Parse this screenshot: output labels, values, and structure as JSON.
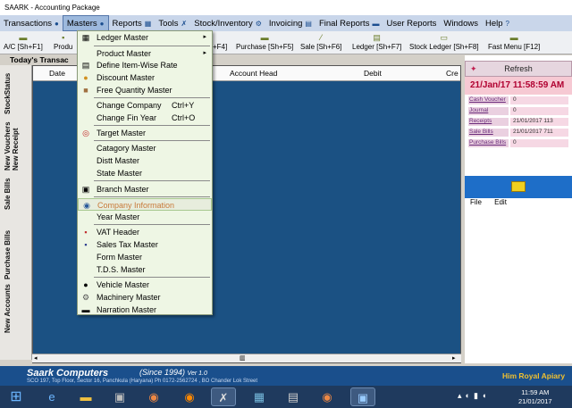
{
  "window": {
    "title": "SAARK - Accounting Package"
  },
  "menubar": [
    {
      "label": "Transactions",
      "icon": "globe-icon"
    },
    {
      "label": "Masters",
      "icon": "globe-icon",
      "active": true
    },
    {
      "label": "Reports",
      "icon": "table-icon"
    },
    {
      "label": "Tools",
      "icon": "wrench-icon"
    },
    {
      "label": "Stock/Inventory",
      "icon": "gear-icon"
    },
    {
      "label": "Invoicing",
      "icon": "document-icon"
    },
    {
      "label": "Final Reports",
      "icon": "panel-icon"
    },
    {
      "label": "User Reports",
      "icon": ""
    },
    {
      "label": "Windows",
      "icon": ""
    },
    {
      "label": "Help",
      "icon": "help-icon"
    }
  ],
  "toolbar": [
    {
      "label": "A/C [Sh+F1]"
    },
    {
      "label": "Produ"
    },
    {
      "label": "+F4]"
    },
    {
      "label": "Purchase [Sh+F5]"
    },
    {
      "label": "Sale [Sh+F6]"
    },
    {
      "label": "Ledger [Sh+F7]"
    },
    {
      "label": "Stock Ledger [Sh+F8]"
    },
    {
      "label": "Fast Menu [F12]"
    }
  ],
  "left": {
    "today_header": "Today's Transac",
    "vtabs": [
      "StockStatus",
      "New Vouchers",
      "New Receipt",
      "Sale Bills",
      "Purchase Bills",
      "New Accounts"
    ]
  },
  "grid": {
    "columns": [
      "Date",
      "Account Head",
      "Debit",
      "Cre"
    ]
  },
  "right": {
    "refresh": "Refresh",
    "datetime": "21/Jan/17 11:58:59 AM",
    "reports": [
      {
        "label": "Cash Voucher",
        "value": "0"
      },
      {
        "label": "Journal",
        "value": "0"
      },
      {
        "label": "Receipts",
        "value": "21/01/2017 113"
      },
      {
        "label": "Sale Bills",
        "value": "21/01/2017 711"
      },
      {
        "label": "Purchase Bills",
        "value": "0"
      }
    ],
    "file_menu": [
      "File",
      "Edit"
    ]
  },
  "status": {
    "company": "Saark Computers",
    "since": "(Since 1994)",
    "version": "Ver 1.0",
    "address": "SCO 197, Top Floor, Sector 16, Panchkula (Haryana) Ph 0172-2562724 , BO Chander Lok Street",
    "firm": "Him Royal Apiary"
  },
  "taskbar": {
    "time": "11:59 AM",
    "date": "21/01/2017"
  },
  "menu": {
    "items": [
      {
        "label": "Ledger Master",
        "icon": "ledger-icon",
        "has_sub": true
      },
      {
        "label": "Product Master",
        "icon": "",
        "has_sub": true
      },
      {
        "label": "Define Item-Wise Rate",
        "icon": "list-icon"
      },
      {
        "label": "Discount Master",
        "icon": "coin-icon"
      },
      {
        "label": "Free Quantity Master",
        "icon": "box-icon"
      },
      {
        "label": "Change Company",
        "shortcut": "Ctrl+Y",
        "icon": ""
      },
      {
        "label": "Change Fin Year",
        "shortcut": "Ctrl+O",
        "icon": ""
      },
      {
        "label": "Target Master",
        "icon": "target-icon"
      },
      {
        "label": "Catagory Master",
        "icon": ""
      },
      {
        "label": "Distt Master",
        "icon": ""
      },
      {
        "label": "State Master",
        "icon": ""
      },
      {
        "label": "Branch Master",
        "icon": "branch-icon"
      },
      {
        "label": "Company Information",
        "icon": "info-icon",
        "highlight": true
      },
      {
        "label": "Year Master",
        "icon": ""
      },
      {
        "label": "VAT Header",
        "icon": "vat-icon"
      },
      {
        "label": "Sales Tax  Master",
        "icon": "tax-icon"
      },
      {
        "label": "Form Master",
        "icon": ""
      },
      {
        "label": "T.D.S. Master",
        "icon": ""
      },
      {
        "label": "Vehicle Master",
        "icon": "car-icon"
      },
      {
        "label": "Machinery Master",
        "icon": "gear-icon"
      },
      {
        "label": "Narration Master",
        "icon": "note-icon"
      }
    ]
  }
}
